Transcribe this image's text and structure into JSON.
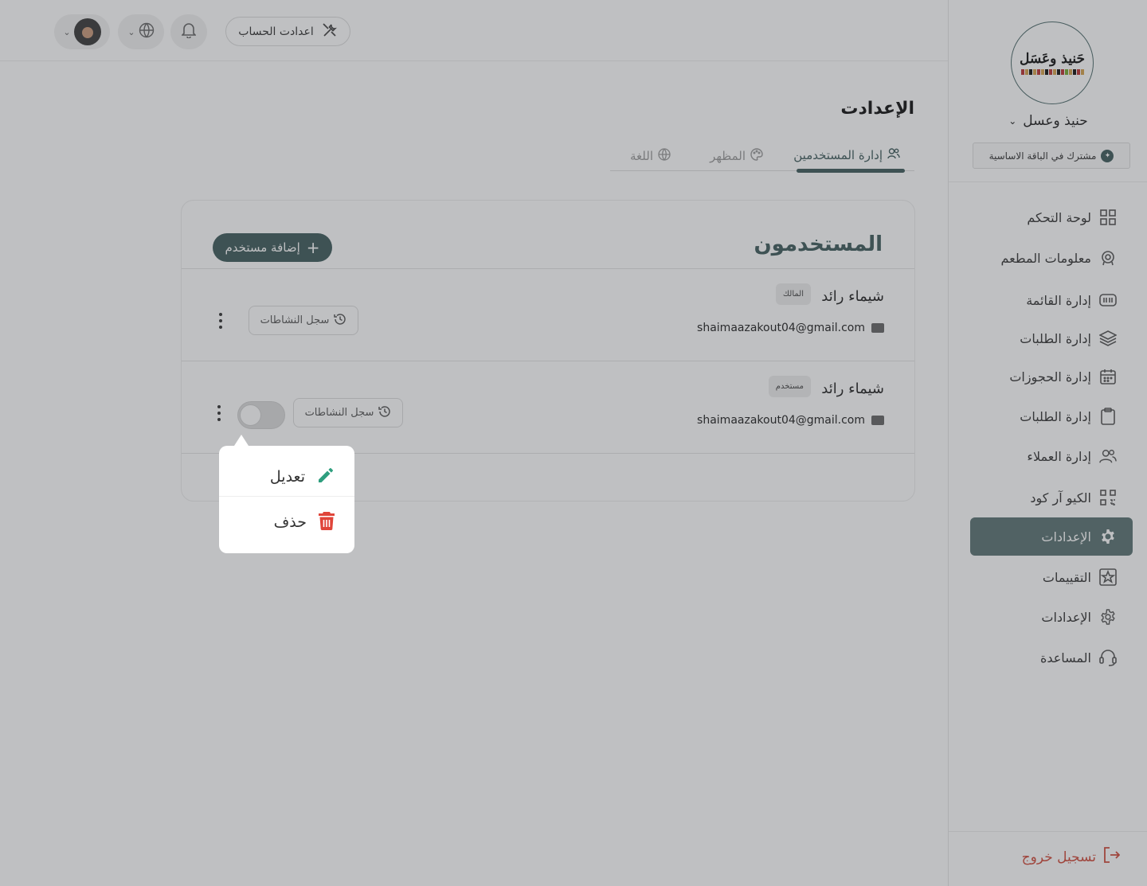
{
  "sidebar": {
    "logo_text": "حَنيذ وعَسَل",
    "brand_name": "حنيذ وعسل",
    "plan_badge": "مشترك في الباقة الاساسية",
    "items": [
      {
        "label": "لوحة التحكم",
        "icon": "grid-icon"
      },
      {
        "label": "معلومات المطعم",
        "icon": "restaurant-icon"
      },
      {
        "label": "إدارة القائمة",
        "icon": "menu-card-icon"
      },
      {
        "label": "إدارة الطلبات",
        "icon": "layers-icon"
      },
      {
        "label": "إدارة الحجوزات",
        "icon": "calendar-icon"
      },
      {
        "label": "إدارة الطلبات",
        "icon": "clipboard-icon"
      },
      {
        "label": "إدارة العملاء",
        "icon": "users-icon"
      },
      {
        "label": "الكيو آر كود",
        "icon": "qr-code-icon"
      },
      {
        "label": "الإعدادات",
        "icon": "gear-icon",
        "active": true
      },
      {
        "label": "التقييمات",
        "icon": "star-icon"
      },
      {
        "label": "الإعدادات",
        "icon": "gear-outline-icon"
      },
      {
        "label": "المساعدة",
        "icon": "headset-icon"
      }
    ],
    "logout_label": "تسجيل خروج"
  },
  "topbar": {
    "account_settings_label": "اعدادت الحساب"
  },
  "main": {
    "page_title": "الإعدادت",
    "tabs": [
      {
        "label": "إدارة المستخدمين",
        "icon": "users-icon",
        "active": true
      },
      {
        "label": "المظهر",
        "icon": "palette-icon"
      },
      {
        "label": "اللغة",
        "icon": "globe-icon"
      }
    ],
    "card_title": "المستخدمون",
    "add_user_label": "إضافة مستخدم",
    "users": [
      {
        "name": "شيماء رائد",
        "role": "المالك",
        "email": "shaimaazakout04@gmail.com",
        "activity_label": "سجل النشاطات"
      },
      {
        "name": "شيماء رائد",
        "role": "مستخدم",
        "email": "shaimaazakout04@gmail.com",
        "activity_label": "سجل النشاطات",
        "enabled": false
      }
    ]
  },
  "dropdown": {
    "edit_label": "تعديل",
    "delete_label": "حذف"
  },
  "colors": {
    "primary": "#3f5b5b",
    "active_nav": "#5b7373",
    "danger": "#d0493a",
    "edit_icon": "#2e9e7e",
    "delete_icon": "#e0453a"
  }
}
